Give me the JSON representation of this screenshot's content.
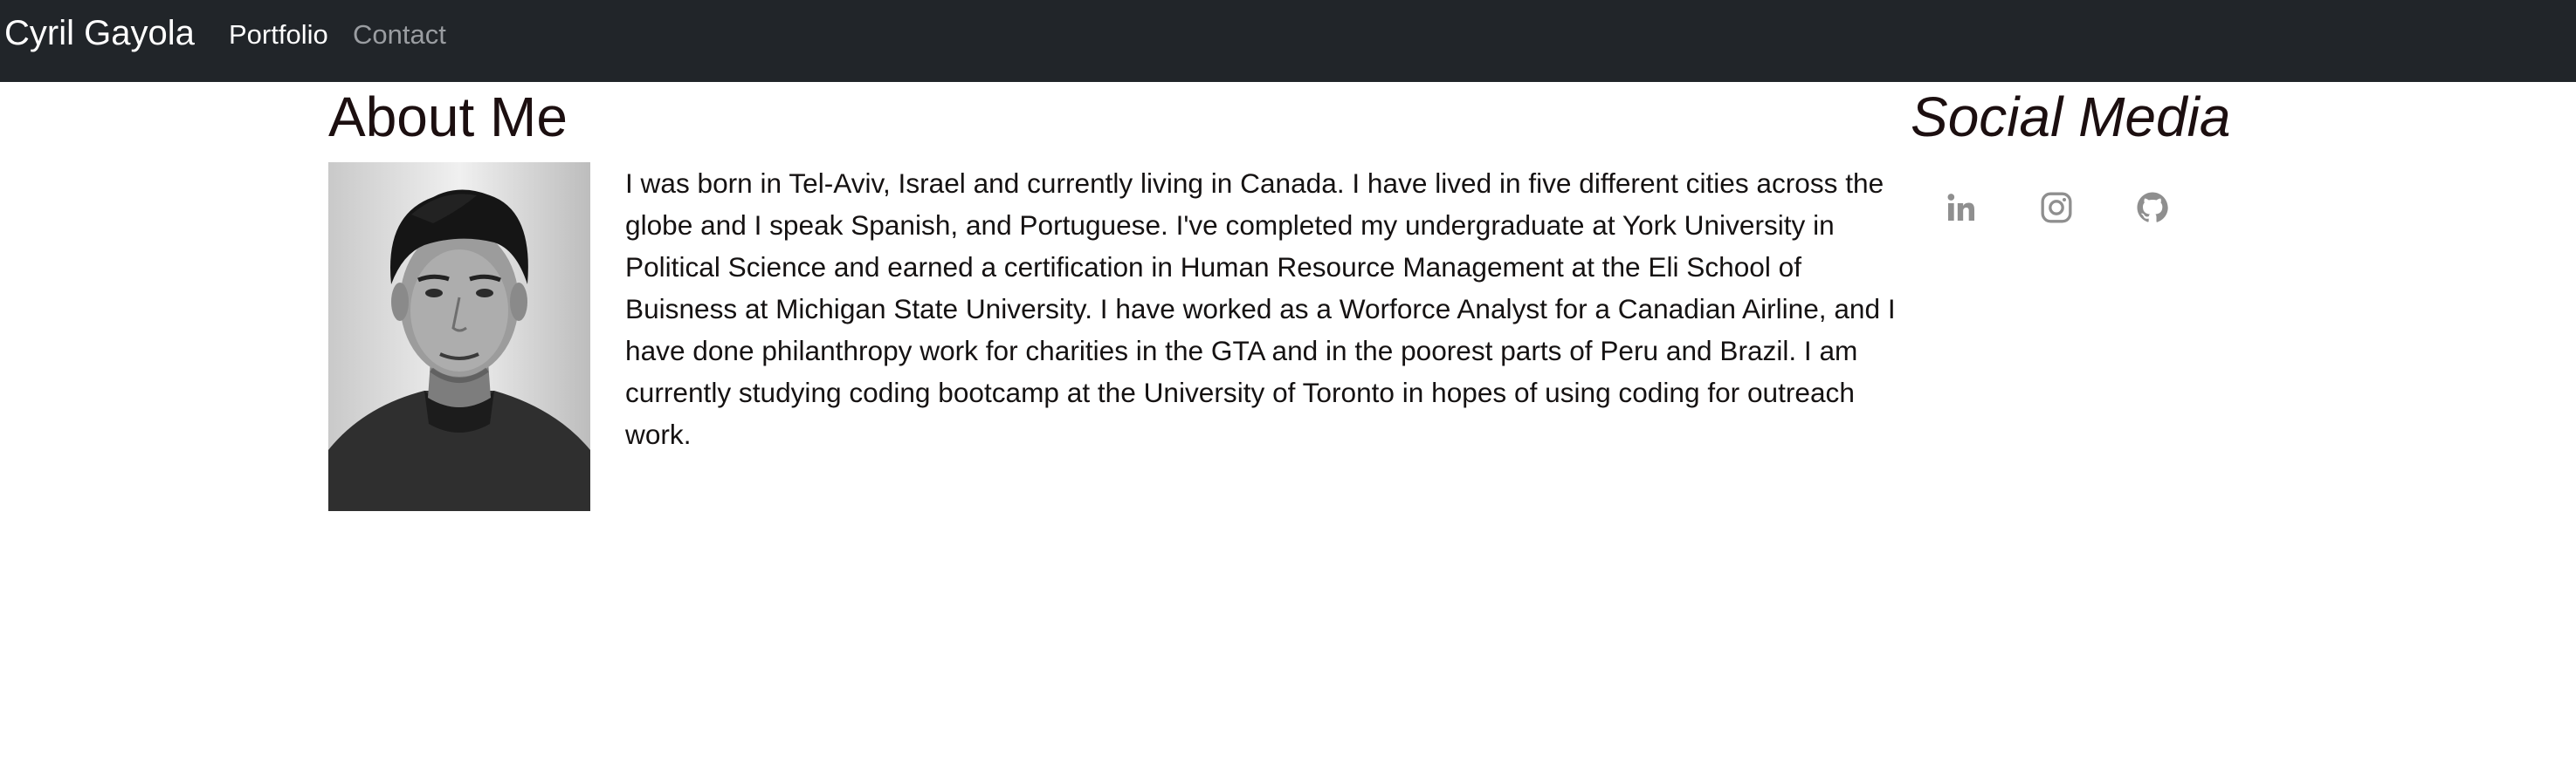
{
  "navbar": {
    "brand": "Cyril Gayola",
    "links": [
      "Portfolio",
      "Contact"
    ]
  },
  "about": {
    "heading": "About Me",
    "bio": "I was born in Tel-Aviv, Israel and currently living in Canada. I have lived in five different cities across the globe and I speak Spanish, and Portuguese. I've completed my undergraduate at York University in Political Science and earned a certification in Human Resource Management at the Eli School of Buisness at Michigan State University. I have worked as a Worforce Analyst for a Canadian Airline, and I have done philanthropy work for charities in the GTA and in the poorest parts of Peru and Brazil. I am currently studying coding bootcamp at the University of Toronto in hopes of using coding for outreach work."
  },
  "social": {
    "heading": "Social Media",
    "icons": [
      "linkedin-icon",
      "instagram-icon",
      "github-icon"
    ]
  },
  "colors": {
    "navbar_bg": "#212529",
    "active_link": "#ffffff",
    "inactive_link": "#9a9da1",
    "icon_gray": "#8f8f8f",
    "heading": "#1c0f10"
  }
}
